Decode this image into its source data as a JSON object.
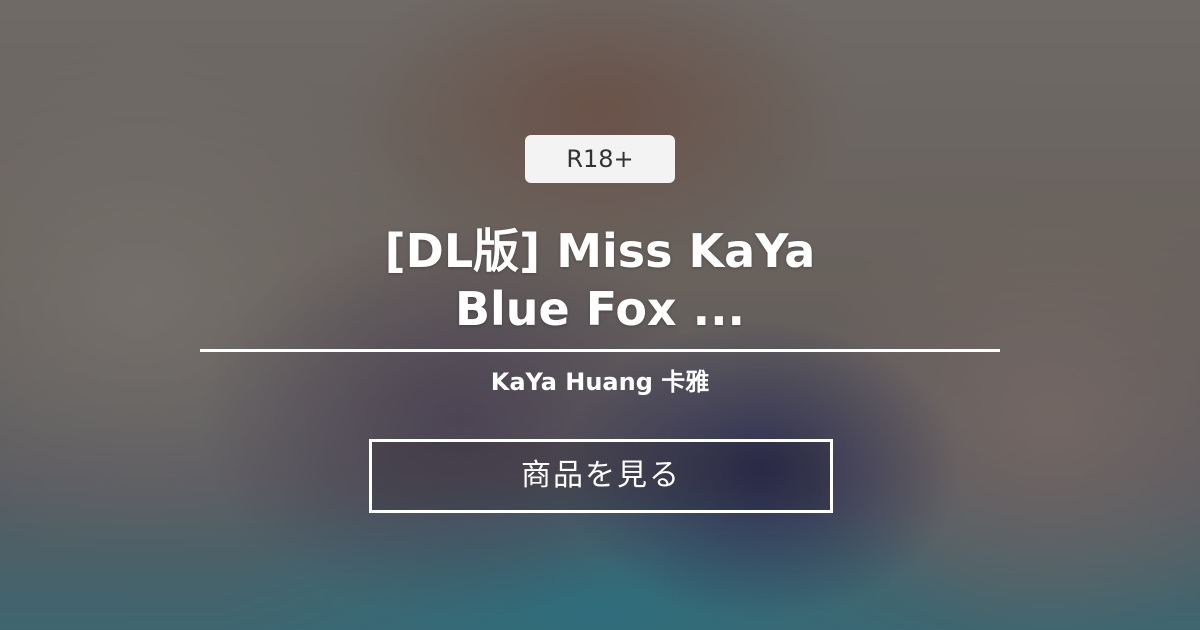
{
  "badge": {
    "label": "R18+"
  },
  "product": {
    "title_line1": "[DL版] Miss KaYa",
    "title_line2": "Blue Fox ...",
    "creator": "KaYa Huang 卡雅"
  },
  "cta": {
    "label": "商品を見る"
  },
  "colors": {
    "text": "#ffffff",
    "badge_bg": "#f3f3f3",
    "badge_text": "#333333"
  }
}
